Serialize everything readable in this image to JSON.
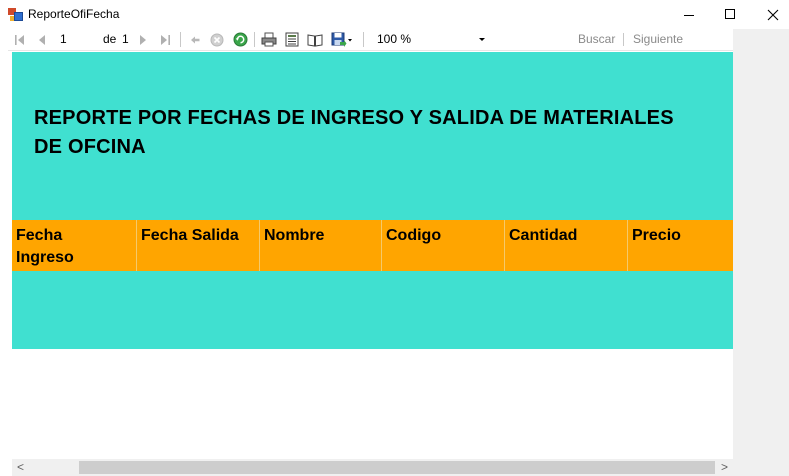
{
  "window": {
    "title": "ReporteOfiFecha",
    "app_icon": "report-app-icon",
    "controls": [
      "minimize-icon",
      "maximize-icon",
      "close-icon"
    ],
    "close_glyph": "✕"
  },
  "toolbar": {
    "current_page": "1",
    "of_label": "de",
    "total_pages": "1",
    "zoom_value": "100 %",
    "search_placeholder": "Buscar",
    "find_next_label": "Siguiente",
    "icons": [
      "first-page-icon",
      "previous-page-icon",
      "next-page-icon",
      "last-page-icon",
      "back-icon",
      "stop-icon",
      "refresh-icon",
      "print-icon",
      "print-layout-icon",
      "page-setup-icon",
      "export-icon"
    ]
  },
  "report": {
    "title": "REPORTE POR FECHAS DE INGRESO Y SALIDA DE MATERIALES\nDE OFCINA",
    "header_color": "#40e0d0",
    "column_header_color": "#ffa500",
    "columns": [
      "Fecha\nIngreso",
      "Fecha Salida",
      "Nombre",
      "Codigo",
      "Cantidad",
      "Precio"
    ]
  },
  "scrollbar": {
    "left_arrow": "<",
    "right_arrow": ">"
  }
}
